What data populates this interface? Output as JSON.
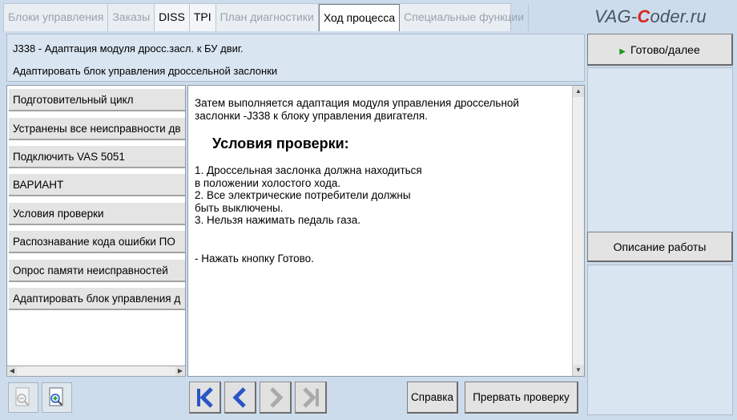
{
  "tabs": [
    {
      "label": "Блоки управления",
      "state": "disabled"
    },
    {
      "label": "Заказы",
      "state": "disabled"
    },
    {
      "label": "DISS",
      "state": "enabled"
    },
    {
      "label": "TPI",
      "state": "enabled"
    },
    {
      "label": "План диагностики",
      "state": "disabled"
    },
    {
      "label": "Ход процесса",
      "state": "active"
    },
    {
      "label": "Специальные функции",
      "state": "disabled"
    }
  ],
  "logo": {
    "prefix": "VAG-",
    "accent": "C",
    "suffix": "oder.ru"
  },
  "header": {
    "title": "J338 - Адаптация модуля дросс.засл. к БУ двиг.",
    "subtitle": "Адаптировать блок управления дроссельной заслонки"
  },
  "steps": [
    "Подготовительный цикл",
    "Устранены все неисправности дв",
    "Подключить VAS 5051",
    "ВАРИАНТ",
    "Условия проверки",
    "Распознавание кода ошибки ПО",
    "Опрос памяти неисправностей",
    "Адаптировать блок управления д"
  ],
  "content": {
    "intro_line1": "Затем выполняется адаптация модуля управления дроссельной",
    "intro_line2": "заслонки -J338 к блоку управления двигателя.",
    "conditions_title": "Условия проверки:",
    "list": [
      "1. Дроссельная заслонка должна находиться",
      "в положении холостого хода.",
      "2. Все электрические потребители должны",
      "быть выключены.",
      "3. Нельзя нажимать педаль газа."
    ],
    "press_instruction": "- Нажать кнопку Готово."
  },
  "right": {
    "ready_label": "Готово/далее",
    "ready_arrow": "▶",
    "description_label": "Описание работы"
  },
  "bottom": {
    "help_label": "Справка",
    "abort_label": "Прервать проверку"
  },
  "icons": {
    "zoom_out": "zoom-out-icon",
    "zoom_in": "zoom-in-icon",
    "first": "skip-first-icon",
    "back": "back-icon",
    "forward": "forward-icon",
    "last": "skip-last-icon"
  },
  "colors": {
    "accent_blue": "#2a55c8",
    "logo_red": "#d9261c",
    "play_green": "#1a9a1a",
    "panel_bg": "#d9e5f1"
  }
}
